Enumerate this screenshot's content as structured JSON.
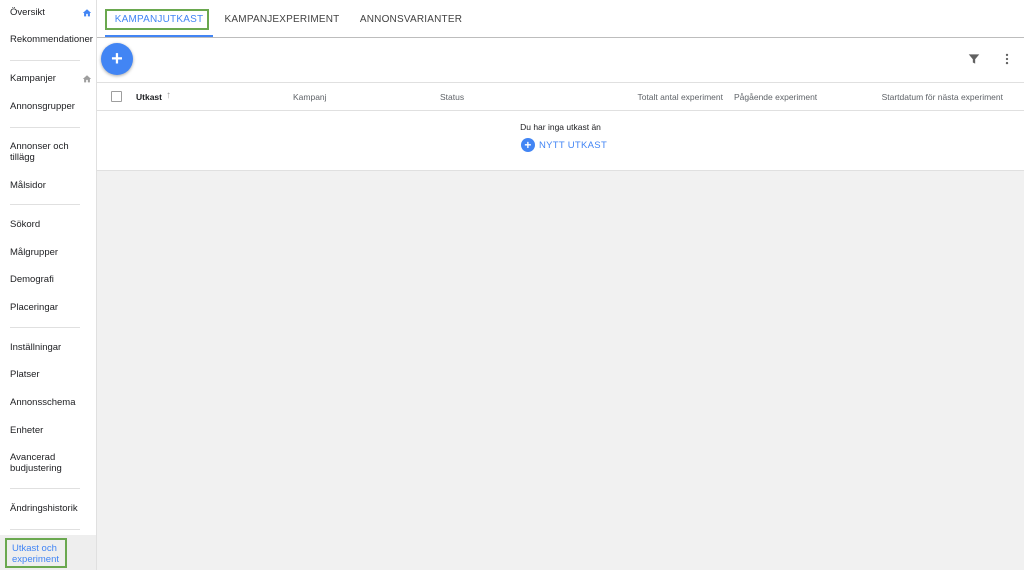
{
  "sidebar": {
    "overview": "Översikt",
    "recommendations": "Rekommendationer",
    "campaigns": "Kampanjer",
    "ad_groups": "Annonsgrupper",
    "ads_extensions_line1": "Annonser och",
    "ads_extensions_line2": "tillägg",
    "landing_pages": "Målsidor",
    "keywords": "Sökord",
    "audiences": "Målgrupper",
    "demographics": "Demografi",
    "placements": "Placeringar",
    "settings": "Inställningar",
    "locations": "Platser",
    "ad_schedule": "Annonsschema",
    "devices": "Enheter",
    "advanced_bid_line1": "Avancerad",
    "advanced_bid_line2": "budjustering",
    "change_history": "Ändringshistorik",
    "drafts_experiments_line1": "Utkast och",
    "drafts_experiments_line2": "experiment"
  },
  "tabs": {
    "drafts": "KAMPANJUTKAST",
    "experiments": "KAMPANJEXPERIMENT",
    "ad_variations": "ANNONSVARIANTER"
  },
  "toolbar": {
    "add_symbol": "+"
  },
  "table": {
    "columns": {
      "draft": "Utkast",
      "campaign": "Kampanj",
      "status": "Status",
      "total_experiments": "Totalt antal experiment",
      "running_experiments": "Pågående experiment",
      "next_start_date": "Startdatum för nästa experiment"
    },
    "sort_symbol": "↑"
  },
  "empty_state": {
    "message": "Du har inga utkast än",
    "button_label": "NYTT UTKAST",
    "button_symbol": "+"
  },
  "colors": {
    "accent": "#4285f4",
    "highlight_outline": "#6aa84f"
  }
}
